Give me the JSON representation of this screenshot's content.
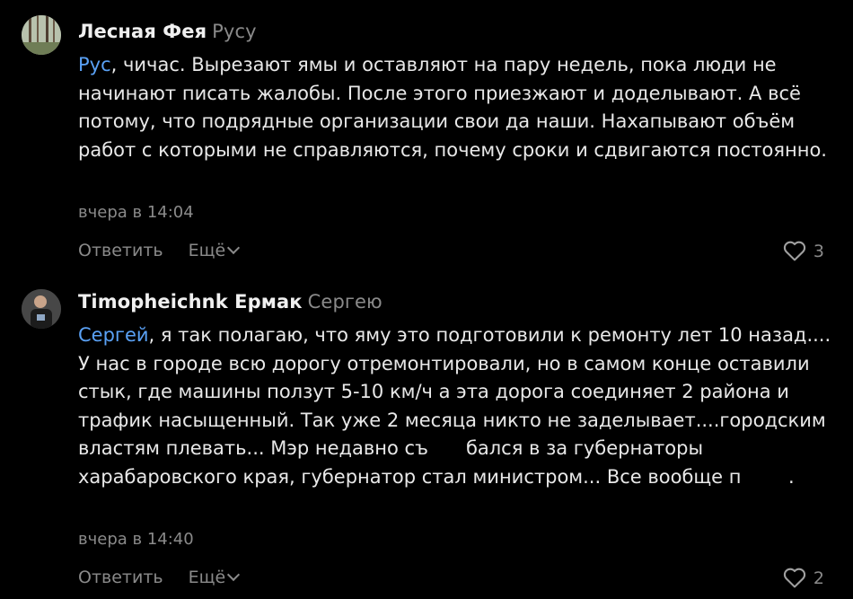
{
  "comments": [
    {
      "author": "Лесная Фея",
      "reply_to": "Русу",
      "mention": "Рус",
      "text": ", чичас. Вырезают ямы и оставляют на пару недель, пока люди не начинают писать жалобы. После этого приезжают и доделывают. А всё потому, что подрядные организации свои да наши. Нахапывают объём работ с которыми не справляются, почему сроки и сдвигаются постоянно.",
      "time": "вчера в 14:04",
      "reply_label": "Ответить",
      "more_label": "Ещё",
      "likes": "3"
    },
    {
      "author": "Timopheichnk Ермак",
      "reply_to": "Сергею",
      "mention": "Сергей",
      "text_1": ", я так полагаю, что яму это подготовили к ремонту лет 10 назад.... У нас в городе всю дорогу отремонтировали, но в самом конце оставили стык, где машины ползут 5-10 км/ч а эта дорога соединяет 2 района и трафик насыщенный. Так уже 2 месяца никто не заделывает....городским властям плевать... Мэр недавно съ",
      "text_2": "бался в за губернаторы харабаровского края, губернатор стал министром... Все вообще п",
      "text_3": ".",
      "time": "вчера в 14:40",
      "reply_label": "Ответить",
      "more_label": "Ещё",
      "likes": "2"
    }
  ]
}
